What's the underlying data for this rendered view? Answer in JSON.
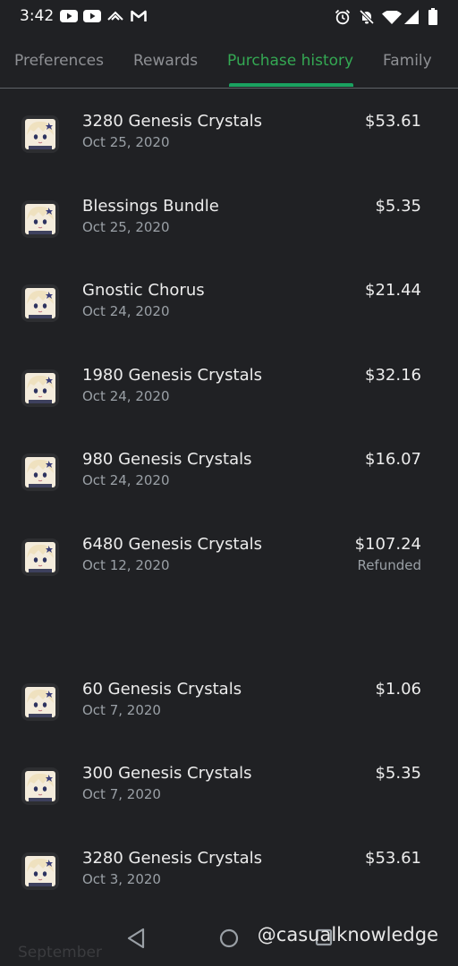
{
  "status_bar": {
    "time": "3:42",
    "left_icons": [
      "youtube-icon",
      "youtube-icon",
      "data-saver-icon",
      "gmail-icon"
    ],
    "right_icons": [
      "alarm-icon",
      "notifications-off-icon",
      "wifi-icon",
      "cell-signal-icon",
      "battery-icon"
    ]
  },
  "tabs": [
    {
      "label": "Preferences"
    },
    {
      "label": "Rewards"
    },
    {
      "label": "Purchase history",
      "active": true
    },
    {
      "label": "Family"
    }
  ],
  "colors": {
    "accent": "#34a853",
    "background": "#202124"
  },
  "purchases": [
    {
      "title": "3280 Genesis Crystals",
      "date": "Oct 25, 2020",
      "price": "$53.61",
      "status": ""
    },
    {
      "title": "Blessings Bundle",
      "date": "Oct 25, 2020",
      "price": "$5.35",
      "status": ""
    },
    {
      "title": "Gnostic Chorus",
      "date": "Oct 24, 2020",
      "price": "$21.44",
      "status": ""
    },
    {
      "title": "1980 Genesis Crystals",
      "date": "Oct 24, 2020",
      "price": "$32.16",
      "status": ""
    },
    {
      "title": "980 Genesis Crystals",
      "date": "Oct 24, 2020",
      "price": "$16.07",
      "status": ""
    },
    {
      "title": "6480 Genesis Crystals",
      "date": "Oct 12, 2020",
      "price": "$107.24",
      "status": "Refunded"
    },
    {
      "title": "60 Genesis Crystals",
      "date": "Oct 7, 2020",
      "price": "$1.06",
      "status": ""
    },
    {
      "title": "300 Genesis Crystals",
      "date": "Oct 7, 2020",
      "price": "$5.35",
      "status": ""
    },
    {
      "title": "3280 Genesis Crystals",
      "date": "Oct 3, 2020",
      "price": "$53.61",
      "status": ""
    }
  ],
  "section_label": "September",
  "nav_bar": {
    "buttons": [
      "back-icon",
      "home-icon",
      "recents-icon"
    ]
  },
  "watermark": "@casualknowledge"
}
